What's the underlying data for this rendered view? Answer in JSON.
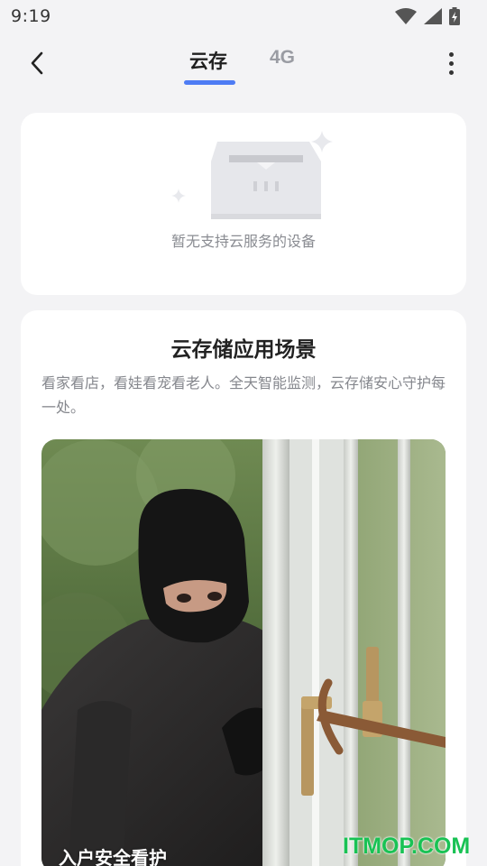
{
  "status": {
    "time": "9:19"
  },
  "header": {
    "tabs": [
      {
        "label": "云存",
        "active": true
      },
      {
        "label": "4G",
        "active": false
      }
    ],
    "accent_color": "#4e7cf4"
  },
  "empty_state": {
    "text": "暂无支持云服务的设备"
  },
  "scenes": {
    "title": "云存储应用场景",
    "description": "看家看店，看娃看宠看老人。全天智能监测，云存储安心守护每一处。",
    "items": [
      {
        "caption": "入户安全看护"
      }
    ]
  },
  "watermark": "ITMOP.COM"
}
